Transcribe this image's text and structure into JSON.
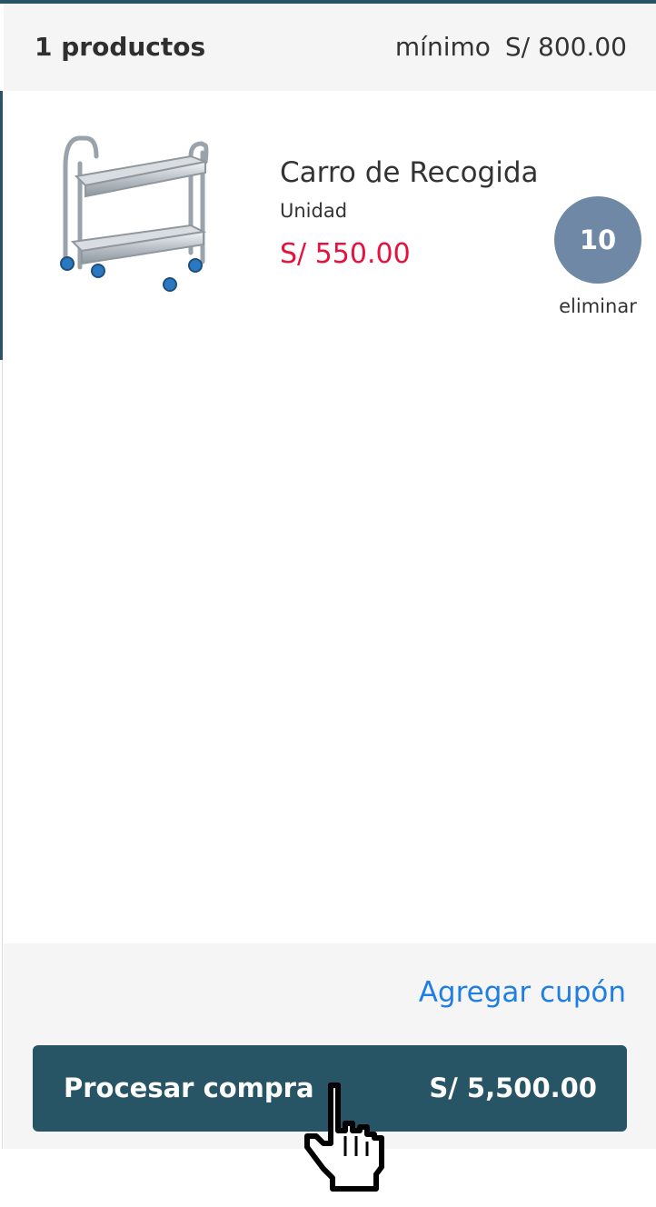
{
  "cart": {
    "count_label": "1 productos",
    "minimum_label": "mínimo",
    "minimum_amount": "S/ 800.00"
  },
  "items": [
    {
      "name": "Carro de Recogida",
      "unit": "Unidad",
      "price": "S/ 550.00",
      "quantity": "10",
      "remove_label": "eliminar",
      "image_icon": "service-trolley-image"
    }
  ],
  "footer": {
    "coupon_label": "Agregar cupón",
    "checkout_label": "Procesar compra",
    "checkout_total": "S/ 5,500.00"
  },
  "colors": {
    "primary": "#275565",
    "price": "#e8103d",
    "link": "#1e7ee3",
    "badge": "#6f88a5"
  }
}
